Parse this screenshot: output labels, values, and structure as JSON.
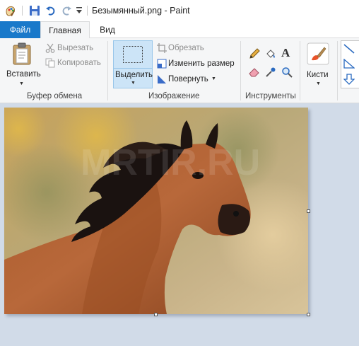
{
  "titlebar": {
    "title": "Безымянный.png - Paint"
  },
  "tabs": {
    "file": "Файл",
    "home": "Главная",
    "view": "Вид"
  },
  "clipboard": {
    "paste": "Вставить",
    "cut": "Вырезать",
    "copy": "Копировать",
    "label": "Буфер обмена"
  },
  "image": {
    "select": "Выделить",
    "crop": "Обрезать",
    "resize": "Изменить размер",
    "rotate": "Повернуть",
    "label": "Изображение"
  },
  "tools": {
    "label": "Инструменты"
  },
  "brushes": {
    "label": "Кисти"
  },
  "canvas": {
    "watermark": "MRTIR.RU"
  },
  "colors": {
    "file_tab": "#1979ca",
    "ribbon_bg": "#f5f6f7",
    "workspace_bg": "#d1dbe8",
    "selection_highlight": "#cce4f7"
  }
}
